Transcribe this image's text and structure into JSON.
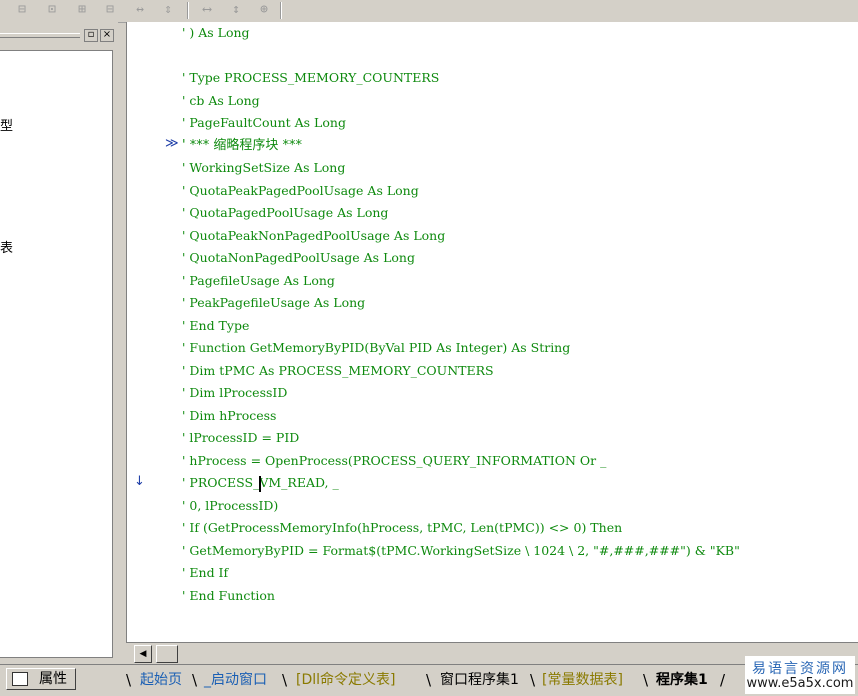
{
  "toolbar": {
    "icons": [
      "align-left-icon",
      "align-center-icon",
      "align-top-icon",
      "align-middle-icon",
      "distribute-h-icon",
      "distribute-v-icon",
      "same-width-icon",
      "same-height-icon",
      "same-size-icon"
    ],
    "glyphs": [
      "⊟",
      "⊡",
      "⊞",
      "⊟",
      "↔",
      "⇕",
      "⟷",
      "↕",
      "⊕"
    ]
  },
  "left_panel": {
    "visible_chars": [
      "型",
      "表"
    ]
  },
  "editor": {
    "lines": [
      "' ) As Long",
      "",
      "' Type PROCESS_MEMORY_COUNTERS",
      "' cb As Long",
      "' PageFaultCount As Long",
      "' *** 缩略程序块 ***",
      "' WorkingSetSize As Long",
      "' QuotaPeakPagedPoolUsage As Long",
      "' QuotaPagedPoolUsage As Long",
      "' QuotaPeakNonPagedPoolUsage As Long",
      "' QuotaNonPagedPoolUsage As Long",
      "' PagefileUsage As Long",
      "' PeakPagefileUsage As Long",
      "' End Type",
      "' Function GetMemoryByPID(ByVal PID As Integer) As String",
      "' Dim tPMC As PROCESS_MEMORY_COUNTERS",
      "' Dim lProcessID",
      "' Dim hProcess",
      "' lProcessID = PID",
      "' hProcess = OpenProcess(PROCESS_QUERY_INFORMATION Or _",
      "' PROCESS_VM_READ, _",
      "' 0, lProcessID)",
      "' If (GetProcessMemoryInfo(hProcess, tPMC, Len(tPMC)) <> 0) Then",
      "' GetMemoryByPID = Format$(tPMC.WorkingSetSize \\ 1024 \\ 2, \"#,###,###\") & \"KB\"",
      "' End If",
      "' End Function"
    ],
    "fold_marker": "≫",
    "current_line_marker": "↓"
  },
  "scrollbar": {
    "left_arrow": "◀"
  },
  "bottom": {
    "properties_label": "属性",
    "tabs": [
      {
        "label": "起始页",
        "color": "#1a5fb4"
      },
      {
        "label": "_启动窗口",
        "color": "#1a5fb4"
      },
      {
        "label": "[Dll命令定义表]",
        "color": "#8a7a00"
      },
      {
        "label": "窗口程序集1",
        "color": "#000000"
      },
      {
        "label": "[常量数据表]",
        "color": "#8a7a00"
      },
      {
        "label": "程序集1",
        "color": "#000000"
      }
    ],
    "watermark_line1": "易语言资源网",
    "watermark_line2": "www.e5a5x.com"
  },
  "colors": {
    "code_green": "#0e8a0e",
    "marker_blue": "#1f3fa8"
  }
}
